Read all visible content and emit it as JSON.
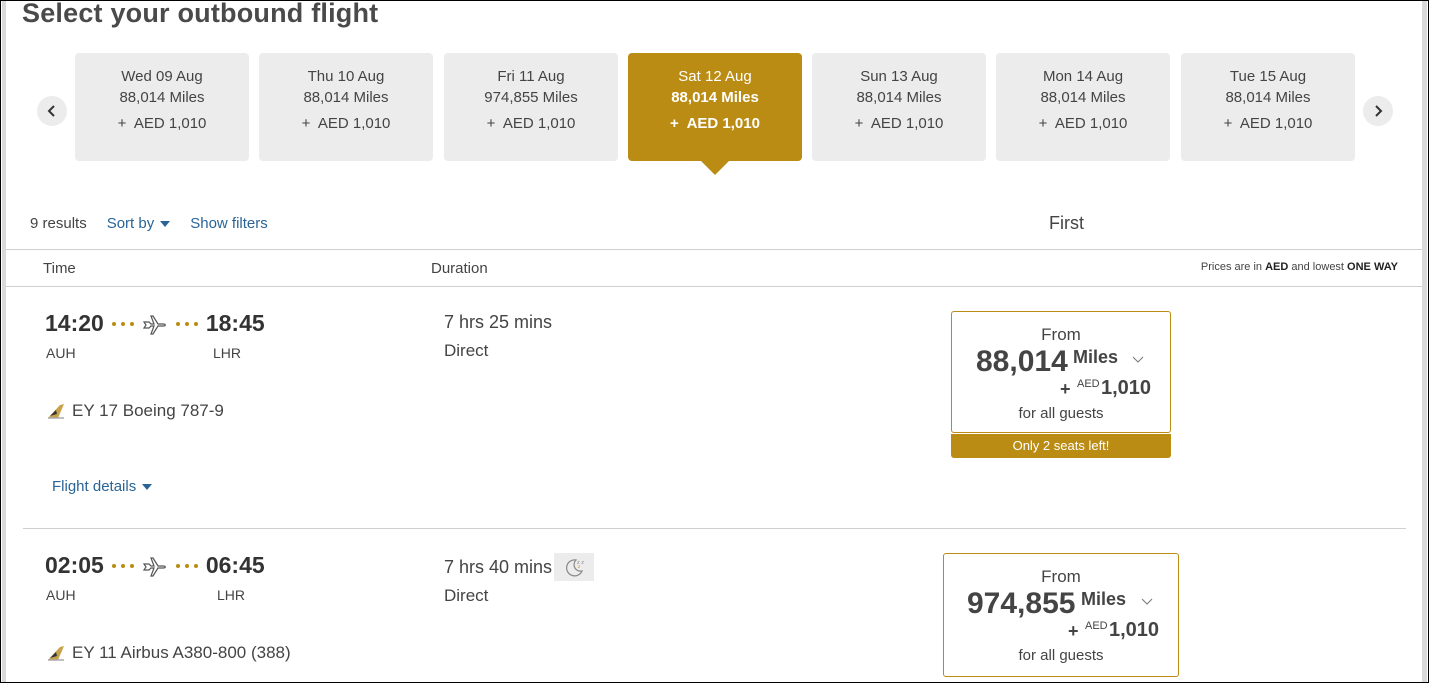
{
  "page": {
    "title": "Select your outbound flight"
  },
  "date_carousel": {
    "prev_icon": "chevron-left-icon",
    "next_icon": "chevron-right-icon",
    "dates": [
      {
        "day": "Wed 09 Aug",
        "miles": "88,014 Miles",
        "cash": "+  AED 1,010",
        "selected": false
      },
      {
        "day": "Thu 10 Aug",
        "miles": "88,014 Miles",
        "cash": "+  AED 1,010",
        "selected": false
      },
      {
        "day": "Fri 11 Aug",
        "miles": "974,855 Miles",
        "cash": "+  AED 1,010",
        "selected": false
      },
      {
        "day": "Sat 12 Aug",
        "miles": "88,014 Miles",
        "cash": "+  AED 1,010",
        "selected": true
      },
      {
        "day": "Sun 13 Aug",
        "miles": "88,014 Miles",
        "cash": "+  AED 1,010",
        "selected": false
      },
      {
        "day": "Mon 14 Aug",
        "miles": "88,014 Miles",
        "cash": "+  AED 1,010",
        "selected": false
      },
      {
        "day": "Tue 15 Aug",
        "miles": "88,014 Miles",
        "cash": "+  AED 1,010",
        "selected": false
      }
    ]
  },
  "results": {
    "count": "9 results",
    "sort_label": "Sort by",
    "filters_label": "Show filters",
    "cabin": "First"
  },
  "columns": {
    "time": "Time",
    "duration": "Duration",
    "price_note_prefix": "Prices are in ",
    "price_note_currency": "AED",
    "price_note_middle": " and lowest ",
    "price_note_trip": "ONE WAY"
  },
  "brand": {
    "accent": "#bb8c14",
    "link": "#2a6496"
  },
  "flights": [
    {
      "depart_time": "14:20",
      "arrive_time": "18:45",
      "origin": "AUH",
      "destination": "LHR",
      "flight_number": "EY 17 Boeing 787-9",
      "duration": "7 hrs 25 mins",
      "overnight": false,
      "stops": "Direct",
      "details_label": "Flight details",
      "fare": {
        "from_label": "From",
        "miles": "88,014",
        "miles_unit": "Miles",
        "plus": "+",
        "currency": "AED",
        "cash": "1,010",
        "guests_label": "for all guests",
        "seats_left": "Only 2 seats left!"
      }
    },
    {
      "depart_time": "02:05",
      "arrive_time": "06:45",
      "origin": "AUH",
      "destination": "LHR",
      "flight_number": "EY 11 Airbus A380-800 (388)",
      "duration": "7 hrs 40 mins",
      "overnight": true,
      "stops": "Direct",
      "fare": {
        "from_label": "From",
        "miles": "974,855",
        "miles_unit": "Miles",
        "plus": "+",
        "currency": "AED",
        "cash": "1,010",
        "guests_label": "for all guests"
      }
    }
  ]
}
